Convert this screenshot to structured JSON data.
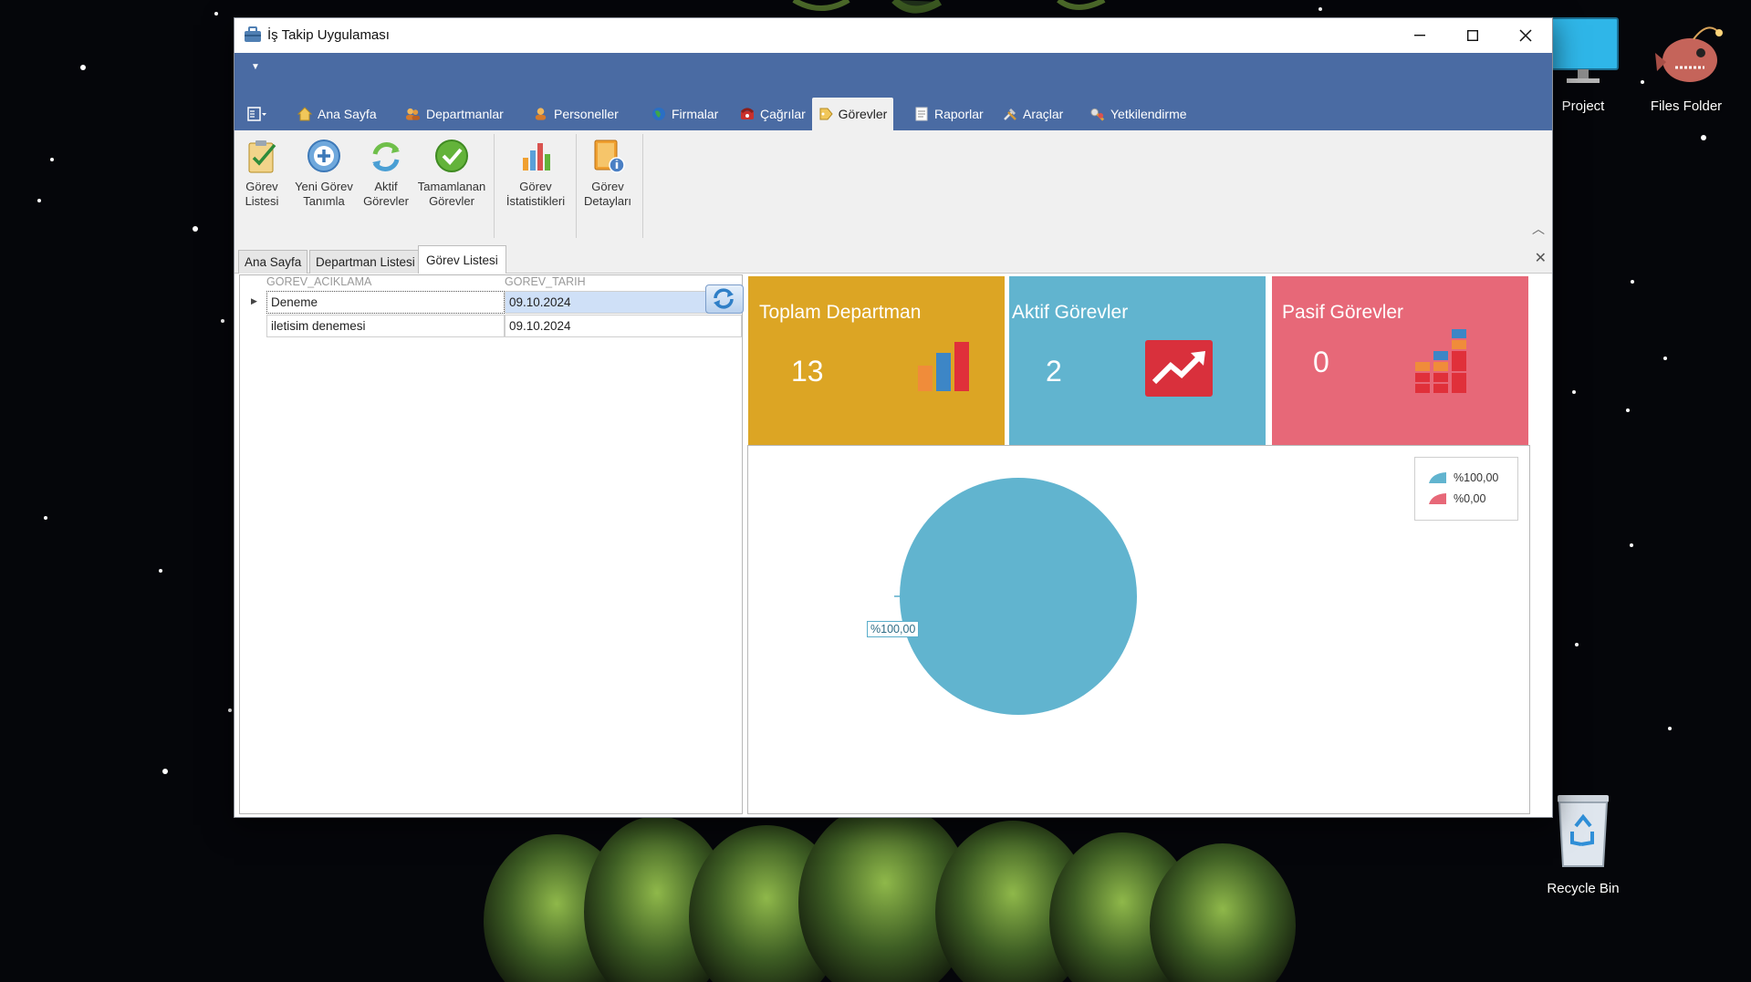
{
  "window": {
    "title": "İş Takip Uygulaması"
  },
  "ribbon": {
    "tabs": [
      {
        "label": "Ana Sayfa",
        "icon": "house-icon"
      },
      {
        "label": "Departmanlar",
        "icon": "people-icon"
      },
      {
        "label": "Personeller",
        "icon": "person-group-icon"
      },
      {
        "label": "Firmalar",
        "icon": "globe-icon"
      },
      {
        "label": "Çağrılar",
        "icon": "phone-icon"
      },
      {
        "label": "Görevler",
        "icon": "tag-icon",
        "active": true
      },
      {
        "label": "Raporlar",
        "icon": "report-icon"
      },
      {
        "label": "Araçlar",
        "icon": "tools-icon"
      },
      {
        "label": "Yetkilendirme",
        "icon": "key-icon"
      }
    ],
    "buttons": {
      "gorev_listesi": "Görev\nListesi",
      "yeni_gorev": "Yeni Görev\nTanımla",
      "aktif_gorevler": "Aktif\nGörevler",
      "tamamlanan_gorevler": "Tamamlanan\nGörevler",
      "gorev_istatistikleri": "Görev\nİstatistikleri",
      "gorev_detaylari": "Görev\nDetayları"
    }
  },
  "document_tabs": [
    {
      "label": "Ana Sayfa"
    },
    {
      "label": "Departman Listesi"
    },
    {
      "label": "Görev Listesi",
      "active": true
    }
  ],
  "grid": {
    "columns": [
      "GOREV_ACIKLAMA",
      "GOREV_TARIH"
    ],
    "rows": [
      [
        "Deneme",
        "09.10.2024"
      ],
      [
        "iletisim denemesi",
        "09.10.2024"
      ]
    ]
  },
  "cards": [
    {
      "title": "Toplam Departman",
      "value": "13",
      "color": "#dca524"
    },
    {
      "title": "Aktif Görevler",
      "value": "2",
      "color": "#61b4cf"
    },
    {
      "title": "Pasif Görevler",
      "value": "0",
      "color": "#e76878"
    }
  ],
  "chart_data": {
    "type": "pie",
    "slices": [
      {
        "label": "%100,00",
        "value": 100,
        "color": "#61b4cf"
      },
      {
        "label": "%0,00",
        "value": 0,
        "color": "#e76878"
      }
    ],
    "legend_position": "top-right",
    "data_labels": [
      "%100,00"
    ]
  },
  "desktop": {
    "icons": [
      {
        "label": "Project",
        "icon": "monitor-icon"
      },
      {
        "label": "Files Folder",
        "icon": "anglerfish-icon"
      },
      {
        "label": "Recycle Bin",
        "icon": "recycle-bin-icon"
      }
    ]
  }
}
